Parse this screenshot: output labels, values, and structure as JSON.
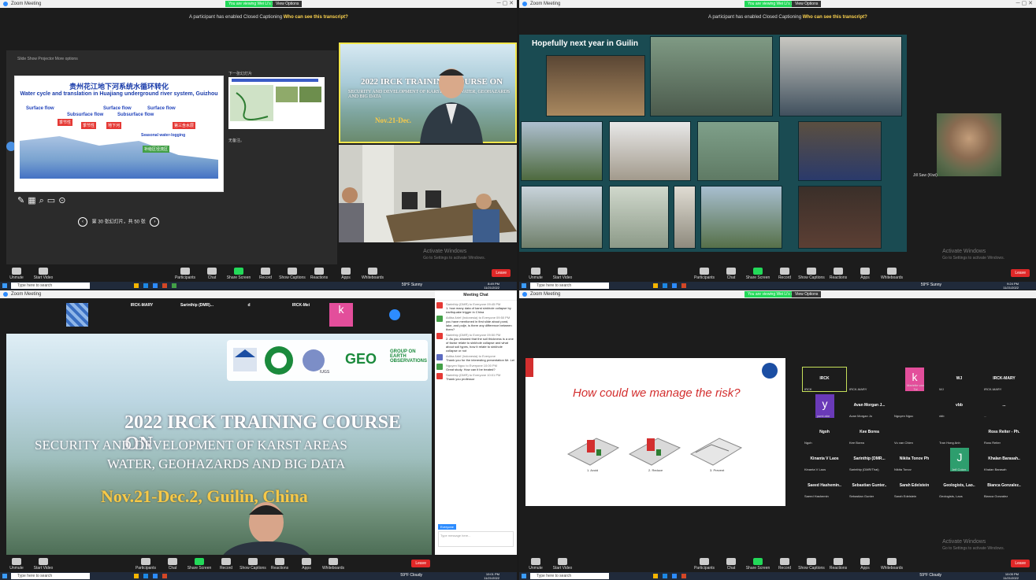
{
  "q1": {
    "titlebar": {
      "app": "Zoom Meeting",
      "share": "You are viewing Wei Li's screen",
      "view": "View Options"
    },
    "caption": {
      "text": "A participant has enabled Closed Captioning",
      "who": "Who can see this transcript?"
    },
    "ppt": {
      "toolbar": "Slide Show   Projector   More options",
      "slide_cn": "贵州花江地下河系统水循环转化",
      "slide_en": "Water cycle and translation in Huajiang underground river system, Guizhou",
      "surface_flow": [
        "Surface flow",
        "Surface flow",
        "Surface flow"
      ],
      "subsurface_flow": [
        "Subsurface flow",
        "Subsurface flow"
      ],
      "red_boxes": [
        "季节性",
        "季节性",
        "地下河",
        "第三含水层"
      ],
      "green_box": "补给区径流区",
      "note": "Seasonal water-logging",
      "next_label": "下一张幻灯片",
      "notes": "无备注。",
      "pager": "第 30 张幻灯片，共 50 张"
    },
    "video1": {
      "title": "2022 IRCK TRAINING COURSE ON",
      "sub": "SECURITY AND DEVELOPMENT OF KARST AREAS WATER, GEOHAZARDS AND BIG DATA",
      "date": "Nov.21-Dec."
    },
    "toolbar": [
      "Unmute",
      "Start Video",
      "Participants",
      "Chat",
      "Share Screen",
      "Record",
      "Show Captions",
      "Reactions",
      "Apps",
      "Whiteboards"
    ],
    "leave": "Leave",
    "activate": {
      "line1": "Activate Windows",
      "line2": "Go to Settings to activate Windows."
    },
    "taskbar": {
      "search": "Type here to search",
      "weather": "59°F Sunny",
      "time": "8:49 PM",
      "date": "11/21/2022"
    }
  },
  "q2": {
    "titlebar": {
      "app": "Zoom Meeting",
      "share": "You are viewing Wei Li's screen",
      "view": "View Options"
    },
    "caption": {
      "text": "A participant has enabled Closed Captioning",
      "who": "Who can see this transcript?"
    },
    "slide_title": "Hopefully next year in Guilin",
    "speaker": "Jill Saw (Kiwi)",
    "toolbar": [
      "Unmute",
      "Start Video",
      "Participants",
      "Chat",
      "Share Screen",
      "Record",
      "Show Captions",
      "Reactions",
      "Apps",
      "Whiteboards"
    ],
    "leave": "Leave",
    "activate": {
      "line1": "Activate Windows",
      "line2": "Go to Settings to activate Windows."
    },
    "taskbar": {
      "search": "Type here to search",
      "weather": "59°F Sunny",
      "time": "9:24 PM",
      "date": "11/21/2022"
    }
  },
  "q3": {
    "titlebar": {
      "app": "Zoom Meeting"
    },
    "strip": [
      {
        "name": "IRCK-MARY",
        "label": "IRCK-MARY"
      },
      {
        "name": "Sarinthip (DMR)...",
        "label": "Sarinthip (DMR/Thailand)"
      },
      {
        "name": "d",
        "label": "d"
      },
      {
        "name": "IRCK-Mei",
        "label": "IRCK-Mei"
      },
      {
        "name": "k",
        "label": "Mariette van Tol"
      }
    ],
    "slide": {
      "l1": "2022 IRCK TRAINING COURSE ON",
      "l2": "SECURITY AND DEVELOPMENT OF KARST AREAS",
      "l3": "WATER, GEOHAZARDS AND BIG DATA",
      "l4": "Nov.21-Dec.2, Guilin, China",
      "geo": "GROUP ON EARTH OBSERVATIONS",
      "iugs": "IUGS"
    },
    "chat": {
      "header": "Meeting Chat",
      "messages": [
        {
          "who": "Sarinthip (DMR)  to Everyone  09:45 PM",
          "text": "1. how many data of karst sinkhole collapse by earthquake trigger in China",
          "color": "#e53935"
        },
        {
          "who": "Adiba Arief (Indonesia)  to Everyone  09:50 PM",
          "text": "you have mentioned in first slide about pond, lake, and polje, is there any difference between them?",
          "color": "#43a047"
        },
        {
          "who": "Sarinthip (DMR)  to Everyone  09:50 PM",
          "text": "2. As you showed that the soil thickness is a one of factor relate to sinkhole collapse and what about soil types, how it relate to sinkhole collapse or not",
          "color": "#e53935"
        },
        {
          "who": "Adiba Arief (Indonesia)  to Everyone",
          "text": "Thank you for the interesting presentation Mr. Lei",
          "color": "#5c6bc0"
        },
        {
          "who": "Nguyen Ngoc  to Everyone  10:00 PM",
          "text": "Great study. How can it be treated?",
          "color": "#43a047"
        },
        {
          "who": "Sarinthip (DMR)  to Everyone  10:01 PM",
          "text": "Thank you professor",
          "color": "#e53935"
        }
      ],
      "to": "Everyone",
      "input": "Type message here..."
    },
    "toolbar": [
      "Unmute",
      "Start Video",
      "Participants",
      "Chat",
      "Share Screen",
      "Record",
      "Show Captions",
      "Reactions",
      "Apps",
      "Whiteboards"
    ],
    "leave": "Leave",
    "taskbar": {
      "search": "Type here to search",
      "weather": "59°F Cloudy",
      "time": "10:01 PM",
      "date": "11/21/2022"
    }
  },
  "q4": {
    "titlebar": {
      "app": "Zoom Meeting",
      "share": "You are viewing Wei Li's screen",
      "view": "View Options"
    },
    "slide_heading": "How could we manage the risk?",
    "slide_labels": [
      "1. Avoid",
      "2. Reduce",
      "3. Prevent"
    ],
    "tiles": [
      {
        "name": "IRCK",
        "label": "IRCK",
        "letter": ""
      },
      {
        "name": "",
        "label": "IRCK-MARY",
        "letter": ""
      },
      {
        "name": "k",
        "label": "Mariette van Tol",
        "letter": "k"
      },
      {
        "name": "WJ",
        "label": "WJ",
        "letter": ""
      },
      {
        "name": "IRCK-MARY",
        "label": "IRCK-MARY",
        "letter": ""
      },
      {
        "name": "y",
        "label": "yumi abe",
        "letter": "y"
      },
      {
        "name": "Avan Morgan J...",
        "label": "Avan Morgan Jo",
        "letter": ""
      },
      {
        "name": "",
        "label": "Nguyen Ngoc",
        "letter": ""
      },
      {
        "name": "vbb",
        "label": "vbb",
        "letter": ""
      },
      {
        "name": "...",
        "label": "...",
        "letter": ""
      },
      {
        "name": "Ngoh",
        "label": "Ngoh",
        "letter": ""
      },
      {
        "name": "Kee Borea",
        "label": "Kee Borea",
        "letter": ""
      },
      {
        "name": "",
        "label": "Vu van Chien",
        "letter": ""
      },
      {
        "name": "",
        "label": "Tran Hong Anh",
        "letter": ""
      },
      {
        "name": "Ross Reiter - Ph.",
        "label": "Ross Reiter",
        "letter": ""
      },
      {
        "name": "Kinanta V Laos",
        "label": "Kinanta V Laos",
        "letter": ""
      },
      {
        "name": "Sarinthip (DMR...",
        "label": "Sarinthip (DMR/Thai)",
        "letter": ""
      },
      {
        "name": "Nikita Tonov Ph",
        "label": "Nikita Tonov",
        "letter": ""
      },
      {
        "name": "J",
        "label": "Jeff Coker",
        "letter": "J"
      },
      {
        "name": "Khalan Barasah..",
        "label": "Khalan Barasah",
        "letter": ""
      },
      {
        "name": "Saeed Hashemin..",
        "label": "Saeed Hashemin",
        "letter": ""
      },
      {
        "name": "Sebastian Gunter..",
        "label": "Sebastian Gunter",
        "letter": ""
      },
      {
        "name": "Sarah Edelstein",
        "label": "Sarah Edelstein",
        "letter": ""
      },
      {
        "name": "Geologists, Lao..",
        "label": "Geologists, Laos",
        "letter": ""
      },
      {
        "name": "Bianca Gonzalez..",
        "label": "Bianca Gonzalez",
        "letter": ""
      }
    ],
    "toolbar": [
      "Unmute",
      "Start Video",
      "Participants",
      "Chat",
      "Share Screen",
      "Record",
      "Show Captions",
      "Reactions",
      "Apps",
      "Whiteboards"
    ],
    "leave": "Leave",
    "activate": {
      "line1": "Activate Windows",
      "line2": "Go to Settings to activate Windows."
    },
    "taskbar": {
      "search": "Type here to search",
      "weather": "59°F Cloudy",
      "time": "10:05 PM",
      "date": "11/21/2022"
    }
  }
}
